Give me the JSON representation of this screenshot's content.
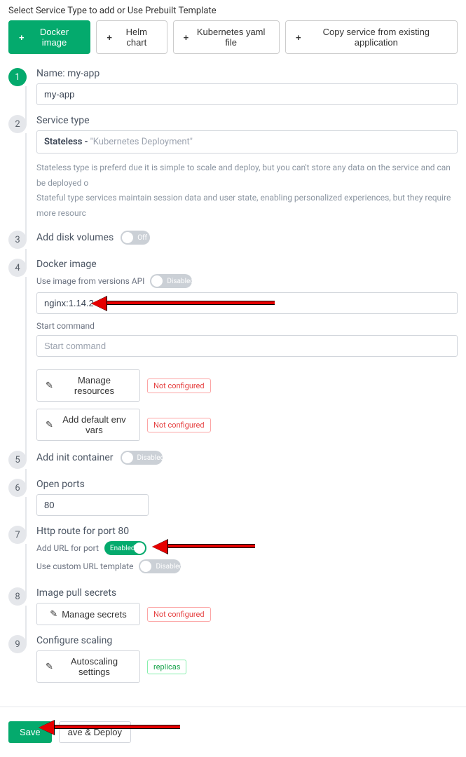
{
  "header": "Select Service Type to add or Use Prebuilt Template",
  "tabs": {
    "docker": "Docker image",
    "helm": "Helm chart",
    "k8s": "Kubernetes yaml file",
    "copy": "Copy service from existing application"
  },
  "steps": {
    "s1": {
      "title": "Name: my-app",
      "value": "my-app"
    },
    "s2": {
      "title": "Service type",
      "select_bold": "Stateless - ",
      "select_quote": "\"Kubernetes Deployment\"",
      "desc1": "Stateless type is preferd due it is simple to scale and deploy, but you can't store any data on the service and can be deployed o",
      "desc2": "Stateful type services maintain session data and user state, enabling personalized experiences, but they require more resourc"
    },
    "s3": {
      "title": "Add disk volumes",
      "toggle": "Off"
    },
    "s4": {
      "title": "Docker image",
      "sub": "Use image from versions API",
      "api_toggle": "Disabled",
      "image_value": "nginx:1.14.2",
      "start_label": "Start command",
      "start_placeholder": "Start command",
      "manage_resources": "Manage resources",
      "add_env": "Add default env vars",
      "not_configured": "Not configured"
    },
    "s5": {
      "title": "Add init container",
      "toggle": "Disabled"
    },
    "s6": {
      "title": "Open ports",
      "value": "80"
    },
    "s7": {
      "title": "Http route for port 80",
      "sub1": "Add URL for port",
      "toggle1": "Enabled",
      "sub2": "Use custom URL template",
      "toggle2": "Disabled"
    },
    "s8": {
      "title": "Image pull secrets",
      "manage": "Manage secrets",
      "badge": "Not configured"
    },
    "s9": {
      "title": "Configure scaling",
      "btn": "Autoscaling settings",
      "badge": "replicas"
    }
  },
  "footer": {
    "save": "Save",
    "deploy": "ave & Deploy"
  }
}
